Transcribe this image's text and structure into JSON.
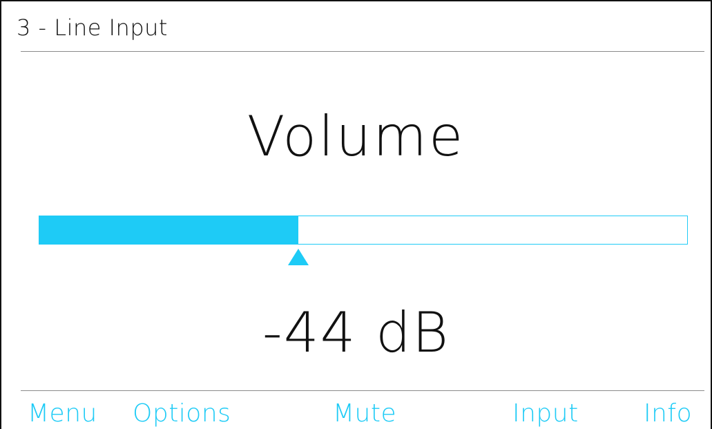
{
  "header": {
    "title": "3 - Line Input"
  },
  "main": {
    "title": "Volume",
    "value_text": "-44 dB",
    "level_fraction": 0.4
  },
  "softkeys": {
    "menu": "Menu",
    "options": "Options",
    "mute": "Mute",
    "input": "Input",
    "info": "Info"
  },
  "colors": {
    "accent": "#1ecbf6",
    "text": "#111111",
    "divider": "#8a8a8a",
    "background": "#ffffff"
  },
  "icons": {
    "level_indicator": "triangle-up-icon"
  }
}
